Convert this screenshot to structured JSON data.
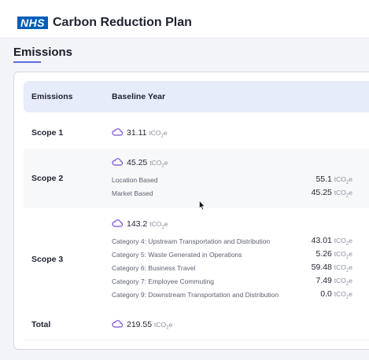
{
  "header": {
    "logo_text": "NHS",
    "title": "Carbon Reduction Plan"
  },
  "section": {
    "title": "Emissions"
  },
  "table": {
    "columns": [
      "Emissions",
      "Baseline Year"
    ],
    "unit": "tCO",
    "unit_sub": "2",
    "unit_suffix": "e",
    "rows": [
      {
        "label": "Scope 1",
        "value": "31.11"
      },
      {
        "label": "Scope 2",
        "value": "45.25",
        "items": [
          {
            "label": "Location Based",
            "value": "55.1"
          },
          {
            "label": "Market Based",
            "value": "45.25"
          }
        ]
      },
      {
        "label": "Scope 3",
        "value": "143.2",
        "items": [
          {
            "label": "Category 4: Upstream Transportation and Distribution",
            "value": "43.01"
          },
          {
            "label": "Category 5: Waste Generated in Operations",
            "value": "5.26"
          },
          {
            "label": "Category 6: Business Travel",
            "value": "59.48"
          },
          {
            "label": "Category 7: Employee Commuting",
            "value": "7.49"
          },
          {
            "label": "Category 9: Downstream Transportation and Distribution",
            "value": "0.0"
          }
        ]
      },
      {
        "label": "Total",
        "value": "219.55"
      }
    ]
  },
  "colors": {
    "brand": "#005eb8",
    "accent": "#5b6ee0",
    "icon": "#7a4fd0",
    "header_row": "#e6ecfa"
  },
  "icons": {
    "value_icon": "cloud-icon",
    "cursor": "mouse-pointer-icon"
  }
}
